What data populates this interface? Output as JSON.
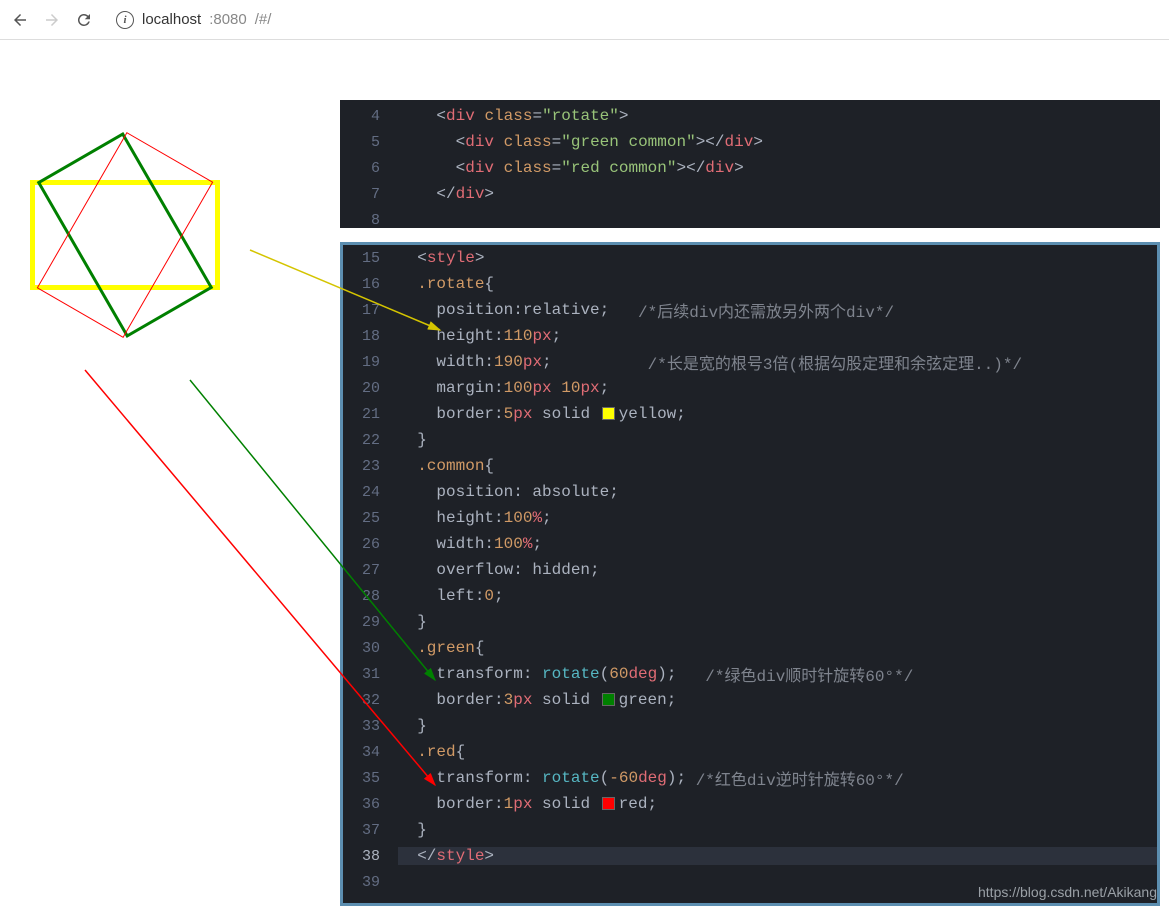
{
  "browser": {
    "host": "localhost",
    "port": ":8080",
    "path": "/#/"
  },
  "panel1": {
    "lines": [
      {
        "num": "4",
        "indent": "    ",
        "parts": [
          {
            "t": "punc",
            "v": "<"
          },
          {
            "t": "tag",
            "v": "div"
          },
          {
            "t": "punc",
            "v": " "
          },
          {
            "t": "attr",
            "v": "class"
          },
          {
            "t": "punc",
            "v": "="
          },
          {
            "t": "str",
            "v": "\"rotate\""
          },
          {
            "t": "punc",
            "v": ">"
          }
        ]
      },
      {
        "num": "5",
        "indent": "      ",
        "parts": [
          {
            "t": "punc",
            "v": "<"
          },
          {
            "t": "tag",
            "v": "div"
          },
          {
            "t": "punc",
            "v": " "
          },
          {
            "t": "attr",
            "v": "class"
          },
          {
            "t": "punc",
            "v": "="
          },
          {
            "t": "str",
            "v": "\"green common\""
          },
          {
            "t": "punc",
            "v": "></"
          },
          {
            "t": "tag",
            "v": "div"
          },
          {
            "t": "punc",
            "v": ">"
          }
        ]
      },
      {
        "num": "6",
        "indent": "      ",
        "parts": [
          {
            "t": "punc",
            "v": "<"
          },
          {
            "t": "tag",
            "v": "div"
          },
          {
            "t": "punc",
            "v": " "
          },
          {
            "t": "attr",
            "v": "class"
          },
          {
            "t": "punc",
            "v": "="
          },
          {
            "t": "str",
            "v": "\"red common\""
          },
          {
            "t": "punc",
            "v": "></"
          },
          {
            "t": "tag",
            "v": "div"
          },
          {
            "t": "punc",
            "v": ">"
          }
        ]
      },
      {
        "num": "7",
        "indent": "    ",
        "parts": [
          {
            "t": "punc",
            "v": "</"
          },
          {
            "t": "tag",
            "v": "div"
          },
          {
            "t": "punc",
            "v": ">"
          }
        ]
      },
      {
        "num": "8",
        "indent": "",
        "parts": []
      }
    ]
  },
  "panel2": {
    "lines": [
      {
        "num": "15",
        "indent": "  ",
        "parts": [
          {
            "t": "punc",
            "v": "<"
          },
          {
            "t": "tag",
            "v": "style"
          },
          {
            "t": "punc",
            "v": ">"
          }
        ]
      },
      {
        "num": "16",
        "indent": "  ",
        "parts": [
          {
            "t": "sel",
            "v": ".rotate"
          },
          {
            "t": "punc",
            "v": "{"
          }
        ]
      },
      {
        "num": "17",
        "indent": "    ",
        "parts": [
          {
            "t": "prop",
            "v": "position"
          },
          {
            "t": "punc",
            "v": ":"
          },
          {
            "t": "prop",
            "v": "relative"
          },
          {
            "t": "punc",
            "v": ";   "
          },
          {
            "t": "cmt",
            "v": "/*后续div内还需放另外两个div*/"
          }
        ]
      },
      {
        "num": "18",
        "indent": "    ",
        "parts": [
          {
            "t": "prop",
            "v": "height"
          },
          {
            "t": "punc",
            "v": ":"
          },
          {
            "t": "num",
            "v": "110"
          },
          {
            "t": "unit",
            "v": "px"
          },
          {
            "t": "punc",
            "v": ";"
          }
        ]
      },
      {
        "num": "19",
        "indent": "    ",
        "parts": [
          {
            "t": "prop",
            "v": "width"
          },
          {
            "t": "punc",
            "v": ":"
          },
          {
            "t": "num",
            "v": "190"
          },
          {
            "t": "unit",
            "v": "px"
          },
          {
            "t": "punc",
            "v": ";          "
          },
          {
            "t": "cmt",
            "v": "/*长是宽的根号3倍(根据勾股定理和余弦定理..)*/"
          }
        ]
      },
      {
        "num": "20",
        "indent": "    ",
        "parts": [
          {
            "t": "prop",
            "v": "margin"
          },
          {
            "t": "punc",
            "v": ":"
          },
          {
            "t": "num",
            "v": "100"
          },
          {
            "t": "unit",
            "v": "px"
          },
          {
            "t": "punc",
            "v": " "
          },
          {
            "t": "num",
            "v": "10"
          },
          {
            "t": "unit",
            "v": "px"
          },
          {
            "t": "punc",
            "v": ";"
          }
        ]
      },
      {
        "num": "21",
        "indent": "    ",
        "parts": [
          {
            "t": "prop",
            "v": "border"
          },
          {
            "t": "punc",
            "v": ":"
          },
          {
            "t": "num",
            "v": "5"
          },
          {
            "t": "unit",
            "v": "px"
          },
          {
            "t": "punc",
            "v": " "
          },
          {
            "t": "prop",
            "v": "solid"
          },
          {
            "t": "punc",
            "v": " "
          },
          {
            "t": "colorbox",
            "v": "yellow"
          },
          {
            "t": "prop",
            "v": "yellow"
          },
          {
            "t": "punc",
            "v": ";"
          }
        ]
      },
      {
        "num": "22",
        "indent": "  ",
        "parts": [
          {
            "t": "punc",
            "v": "}"
          }
        ]
      },
      {
        "num": "23",
        "indent": "  ",
        "parts": [
          {
            "t": "sel",
            "v": ".common"
          },
          {
            "t": "punc",
            "v": "{"
          }
        ]
      },
      {
        "num": "24",
        "indent": "    ",
        "parts": [
          {
            "t": "prop",
            "v": "position"
          },
          {
            "t": "punc",
            "v": ": "
          },
          {
            "t": "prop",
            "v": "absolute"
          },
          {
            "t": "punc",
            "v": ";"
          }
        ]
      },
      {
        "num": "25",
        "indent": "    ",
        "parts": [
          {
            "t": "prop",
            "v": "height"
          },
          {
            "t": "punc",
            "v": ":"
          },
          {
            "t": "num",
            "v": "100"
          },
          {
            "t": "unit",
            "v": "%"
          },
          {
            "t": "punc",
            "v": ";"
          }
        ]
      },
      {
        "num": "26",
        "indent": "    ",
        "parts": [
          {
            "t": "prop",
            "v": "width"
          },
          {
            "t": "punc",
            "v": ":"
          },
          {
            "t": "num",
            "v": "100"
          },
          {
            "t": "unit",
            "v": "%"
          },
          {
            "t": "punc",
            "v": ";"
          }
        ]
      },
      {
        "num": "27",
        "indent": "    ",
        "parts": [
          {
            "t": "prop",
            "v": "overflow"
          },
          {
            "t": "punc",
            "v": ": "
          },
          {
            "t": "prop",
            "v": "hidden"
          },
          {
            "t": "punc",
            "v": ";"
          }
        ]
      },
      {
        "num": "28",
        "indent": "    ",
        "parts": [
          {
            "t": "prop",
            "v": "left"
          },
          {
            "t": "punc",
            "v": ":"
          },
          {
            "t": "num",
            "v": "0"
          },
          {
            "t": "punc",
            "v": ";"
          }
        ]
      },
      {
        "num": "29",
        "indent": "  ",
        "parts": [
          {
            "t": "punc",
            "v": "}"
          }
        ]
      },
      {
        "num": "30",
        "indent": "  ",
        "parts": [
          {
            "t": "sel",
            "v": ".green"
          },
          {
            "t": "punc",
            "v": "{"
          }
        ]
      },
      {
        "num": "31",
        "indent": "    ",
        "parts": [
          {
            "t": "prop",
            "v": "transform"
          },
          {
            "t": "punc",
            "v": ": "
          },
          {
            "t": "func",
            "v": "rotate"
          },
          {
            "t": "punc",
            "v": "("
          },
          {
            "t": "num",
            "v": "60"
          },
          {
            "t": "unit",
            "v": "deg"
          },
          {
            "t": "punc",
            "v": ");   "
          },
          {
            "t": "cmt",
            "v": "/*绿色div顺时针旋转60°*/"
          }
        ]
      },
      {
        "num": "32",
        "indent": "    ",
        "parts": [
          {
            "t": "prop",
            "v": "border"
          },
          {
            "t": "punc",
            "v": ":"
          },
          {
            "t": "num",
            "v": "3"
          },
          {
            "t": "unit",
            "v": "px"
          },
          {
            "t": "punc",
            "v": " "
          },
          {
            "t": "prop",
            "v": "solid"
          },
          {
            "t": "punc",
            "v": " "
          },
          {
            "t": "colorbox",
            "v": "green"
          },
          {
            "t": "prop",
            "v": "green"
          },
          {
            "t": "punc",
            "v": ";"
          }
        ]
      },
      {
        "num": "33",
        "indent": "  ",
        "parts": [
          {
            "t": "punc",
            "v": "}"
          }
        ]
      },
      {
        "num": "34",
        "indent": "  ",
        "parts": [
          {
            "t": "sel",
            "v": ".red"
          },
          {
            "t": "punc",
            "v": "{"
          }
        ]
      },
      {
        "num": "35",
        "indent": "    ",
        "parts": [
          {
            "t": "prop",
            "v": "transform"
          },
          {
            "t": "punc",
            "v": ": "
          },
          {
            "t": "func",
            "v": "rotate"
          },
          {
            "t": "punc",
            "v": "("
          },
          {
            "t": "num",
            "v": "-60"
          },
          {
            "t": "unit",
            "v": "deg"
          },
          {
            "t": "punc",
            "v": "); "
          },
          {
            "t": "cmt",
            "v": "/*红色div逆时针旋转60°*/"
          }
        ]
      },
      {
        "num": "36",
        "indent": "    ",
        "parts": [
          {
            "t": "prop",
            "v": "border"
          },
          {
            "t": "punc",
            "v": ":"
          },
          {
            "t": "num",
            "v": "1"
          },
          {
            "t": "unit",
            "v": "px"
          },
          {
            "t": "punc",
            "v": " "
          },
          {
            "t": "prop",
            "v": "solid"
          },
          {
            "t": "punc",
            "v": " "
          },
          {
            "t": "colorbox",
            "v": "red"
          },
          {
            "t": "prop",
            "v": "red"
          },
          {
            "t": "punc",
            "v": ";"
          }
        ]
      },
      {
        "num": "37",
        "indent": "  ",
        "parts": [
          {
            "t": "punc",
            "v": "}"
          }
        ]
      },
      {
        "num": "38",
        "indent": "  ",
        "active": true,
        "parts": [
          {
            "t": "punc",
            "v": "</"
          },
          {
            "t": "tag",
            "v": "style"
          },
          {
            "t": "punc",
            "v": ">"
          }
        ]
      },
      {
        "num": "39",
        "indent": "",
        "parts": []
      }
    ]
  },
  "watermark": "https://blog.csdn.net/Akikang"
}
